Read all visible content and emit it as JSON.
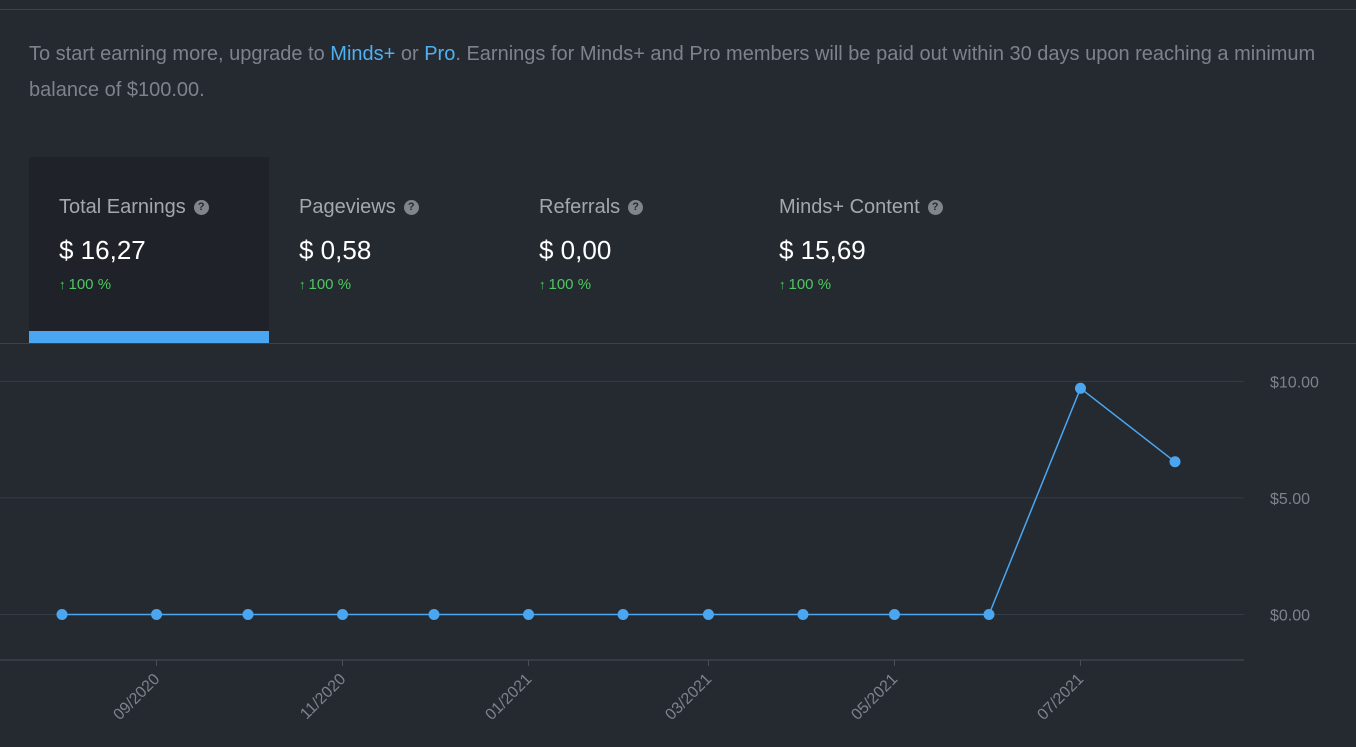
{
  "notice": {
    "prefix": "To start earning more, upgrade to ",
    "link1": "Minds+",
    "middle": " or ",
    "link2": "Pro",
    "suffix": ". Earnings for Minds+ and Pro members will be paid out within 30 days upon reaching a minimum balance of $100.00."
  },
  "tabs": [
    {
      "label": "Total Earnings",
      "value": "$ 16,27",
      "trend": "100 %"
    },
    {
      "label": "Pageviews",
      "value": "$ 0,58",
      "trend": "100 %"
    },
    {
      "label": "Referrals",
      "value": "$ 0,00",
      "trend": "100 %"
    },
    {
      "label": "Minds+ Content",
      "value": "$ 15,69",
      "trend": "100 %"
    }
  ],
  "colors": {
    "accent": "#4ba6f1",
    "trend_up": "#4cc860",
    "background": "#252a31"
  },
  "icons": {
    "help": "question-circle-icon",
    "trend": "arrow-up-icon"
  },
  "chart_data": {
    "type": "line",
    "x": [
      "2020-08-01",
      "2020-09-01",
      "2020-10-01",
      "2020-11-01",
      "2020-12-01",
      "2021-01-01",
      "2021-02-01",
      "2021-03-01",
      "2021-04-01",
      "2021-05-01",
      "2021-06-01",
      "2021-07-01",
      "2021-08-01"
    ],
    "values": [
      0,
      0,
      0,
      0,
      0,
      0,
      0,
      0,
      0,
      0,
      0,
      9.7,
      6.55
    ],
    "x_tick_labels": [
      "09/2020",
      "11/2020",
      "01/2021",
      "03/2021",
      "05/2021",
      "07/2021"
    ],
    "y_tick_labels": [
      "$10.00",
      "$5.00",
      "$0.00"
    ],
    "ylim": [
      -1.95,
      11.6
    ],
    "grid": true,
    "color": "#4ba6f1"
  }
}
